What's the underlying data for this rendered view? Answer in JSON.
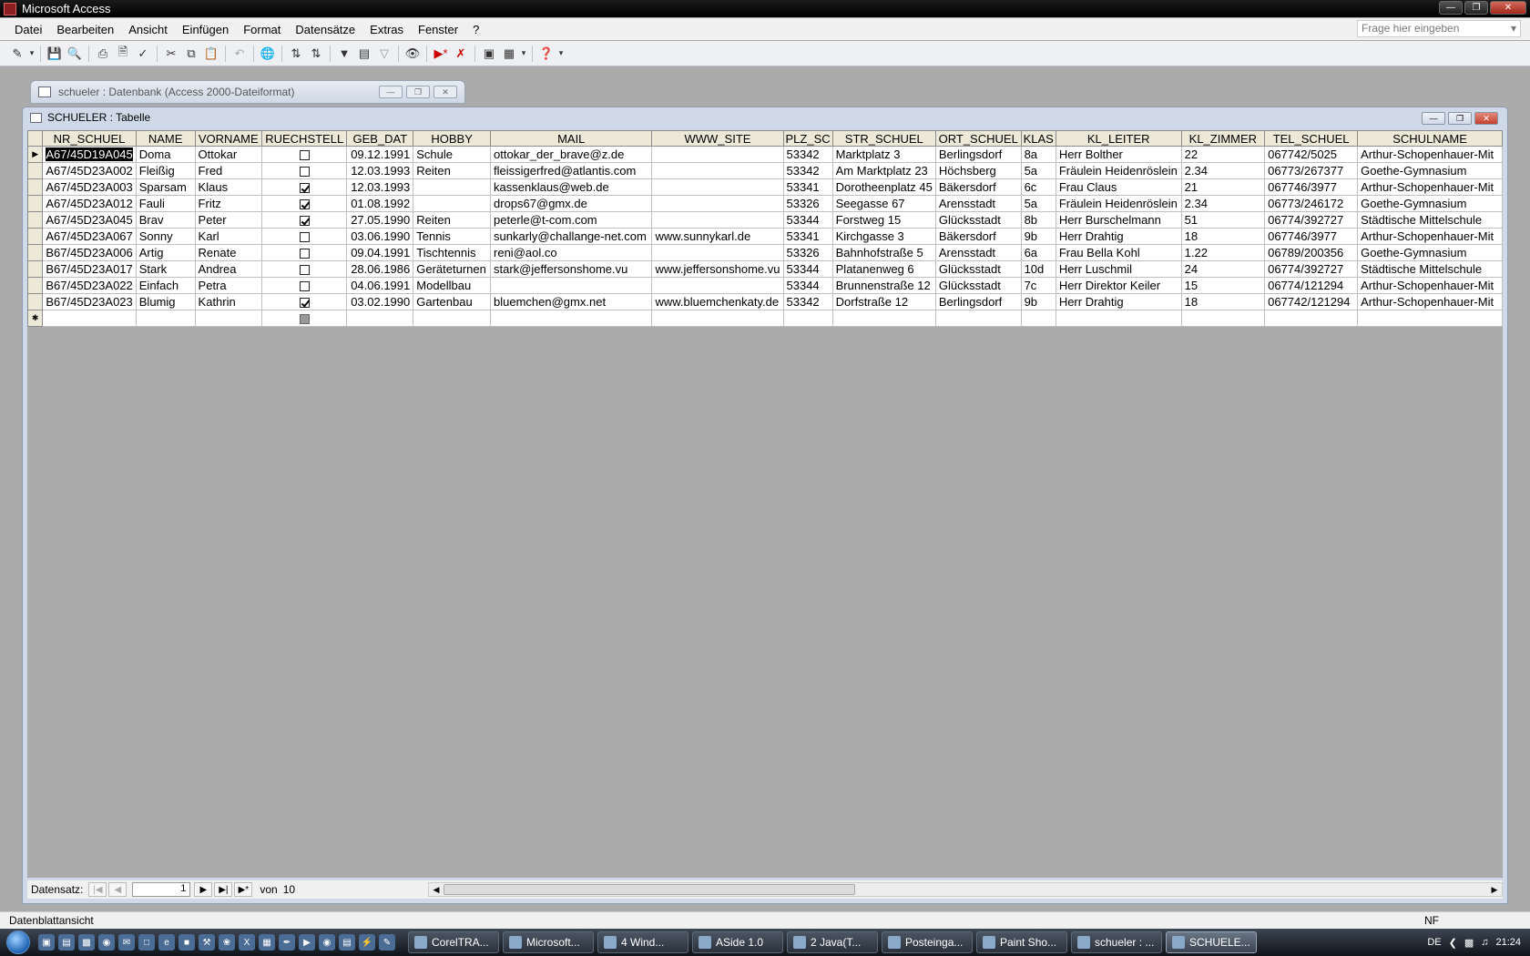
{
  "app": {
    "title": "Microsoft Access"
  },
  "menu": [
    "Datei",
    "Bearbeiten",
    "Ansicht",
    "Einfügen",
    "Format",
    "Datensätze",
    "Extras",
    "Fenster",
    "?"
  ],
  "help_search": {
    "placeholder": "Frage hier eingeben"
  },
  "db_window": {
    "title": "schueler : Datenbank (Access 2000-Dateiformat)"
  },
  "table_window": {
    "title": "SCHUELER : Tabelle"
  },
  "columns": [
    "NR_SCHUEL",
    "NAME",
    "VORNAME",
    "RUECHSTELL",
    "GEB_DAT",
    "HOBBY",
    "MAIL",
    "WWW_SITE",
    "PLZ_SC",
    "STR_SCHUEL",
    "ORT_SCHUEL",
    "KLAS",
    "KL_LEITER",
    "KL_ZIMMER",
    "TEL_SCHUEL",
    "SCHULNAME"
  ],
  "rows": [
    {
      "nr": "A67/45D19A045",
      "name": "Doma",
      "vorname": "Ottokar",
      "rueck": false,
      "geb": "09.12.1991",
      "hobby": "Schule",
      "mail": "ottokar_der_brave@z.de",
      "www": "",
      "plz": "53342",
      "str": "Marktplatz 3",
      "ort": "Berlingsdorf",
      "klasse": "8a",
      "leiter": "Herr Bolther",
      "zimmer": "22",
      "tel": "067742/5025",
      "schule": "Arthur-Schopenhauer-Mit"
    },
    {
      "nr": "A67/45D23A002",
      "name": "Fleißig",
      "vorname": "Fred",
      "rueck": false,
      "geb": "12.03.1993",
      "hobby": "Reiten",
      "mail": "fleissigerfred@atlantis.com",
      "www": "",
      "plz": "53342",
      "str": "Am Marktplatz 23",
      "ort": "Höchsberg",
      "klasse": "5a",
      "leiter": "Fräulein Heidenröslein",
      "zimmer": "2.34",
      "tel": "06773/267377",
      "schule": "Goethe-Gymnasium"
    },
    {
      "nr": "A67/45D23A003",
      "name": "Sparsam",
      "vorname": "Klaus",
      "rueck": true,
      "geb": "12.03.1993",
      "hobby": "",
      "mail": "kassenklaus@web.de",
      "www": "",
      "plz": "53341",
      "str": "Dorotheenplatz 45",
      "ort": "Bäkersdorf",
      "klasse": "6c",
      "leiter": "Frau Claus",
      "zimmer": "21",
      "tel": "067746/3977",
      "schule": "Arthur-Schopenhauer-Mit"
    },
    {
      "nr": "A67/45D23A012",
      "name": "Fauli",
      "vorname": "Fritz",
      "rueck": true,
      "geb": "01.08.1992",
      "hobby": "",
      "mail": "drops67@gmx.de",
      "www": "",
      "plz": "53326",
      "str": "Seegasse 67",
      "ort": "Arensstadt",
      "klasse": "5a",
      "leiter": "Fräulein Heidenröslein",
      "zimmer": "2.34",
      "tel": "06773/246172",
      "schule": "Goethe-Gymnasium"
    },
    {
      "nr": "A67/45D23A045",
      "name": "Brav",
      "vorname": "Peter",
      "rueck": true,
      "geb": "27.05.1990",
      "hobby": "Reiten",
      "mail": "peterle@t-com.com",
      "www": "",
      "plz": "53344",
      "str": "Forstweg 15",
      "ort": "Glücksstadt",
      "klasse": "8b",
      "leiter": "Herr Burschelmann",
      "zimmer": "51",
      "tel": "06774/392727",
      "schule": "Städtische Mittelschule"
    },
    {
      "nr": "A67/45D23A067",
      "name": "Sonny",
      "vorname": "Karl",
      "rueck": false,
      "geb": "03.06.1990",
      "hobby": "Tennis",
      "mail": "sunkarly@challange-net.com",
      "www": "www.sunnykarl.de",
      "plz": "53341",
      "str": "Kirchgasse 3",
      "ort": "Bäkersdorf",
      "klasse": "9b",
      "leiter": "Herr Drahtig",
      "zimmer": "18",
      "tel": "067746/3977",
      "schule": "Arthur-Schopenhauer-Mit"
    },
    {
      "nr": "B67/45D23A006",
      "name": "Artig",
      "vorname": "Renate",
      "rueck": false,
      "geb": "09.04.1991",
      "hobby": "Tischtennis",
      "mail": "reni@aol.co",
      "www": "",
      "plz": "53326",
      "str": "Bahnhofstraße 5",
      "ort": "Arensstadt",
      "klasse": "6a",
      "leiter": "Frau Bella Kohl",
      "zimmer": "1.22",
      "tel": "06789/200356",
      "schule": "Goethe-Gymnasium"
    },
    {
      "nr": "B67/45D23A017",
      "name": "Stark",
      "vorname": "Andrea",
      "rueck": false,
      "geb": "28.06.1986",
      "hobby": "Geräteturnen",
      "mail": "stark@jeffersonshome.vu",
      "www": "www.jeffersonshome.vu",
      "plz": "53344",
      "str": "Platanenweg 6",
      "ort": "Glücksstadt",
      "klasse": "10d",
      "leiter": "Herr Luschmil",
      "zimmer": "24",
      "tel": "06774/392727",
      "schule": "Städtische Mittelschule"
    },
    {
      "nr": "B67/45D23A022",
      "name": "Einfach",
      "vorname": "Petra",
      "rueck": false,
      "geb": "04.06.1991",
      "hobby": "Modellbau",
      "mail": "",
      "www": "",
      "plz": "53344",
      "str": "Brunnenstraße 12",
      "ort": "Glücksstadt",
      "klasse": "7c",
      "leiter": "Herr Direktor Keiler",
      "zimmer": "15",
      "tel": "06774/121294",
      "schule": "Arthur-Schopenhauer-Mit"
    },
    {
      "nr": "B67/45D23A023",
      "name": "Blumig",
      "vorname": "Kathrin",
      "rueck": true,
      "geb": "03.02.1990",
      "hobby": "Gartenbau",
      "mail": "bluemchen@gmx.net",
      "www": "www.bluemchenkaty.de",
      "plz": "53342",
      "str": "Dorfstraße 12",
      "ort": "Berlingsdorf",
      "klasse": "9b",
      "leiter": "Herr Drahtig",
      "zimmer": "18",
      "tel": "067742/121294",
      "schule": "Arthur-Schopenhauer-Mit"
    }
  ],
  "record_nav": {
    "label": "Datensatz:",
    "current": "1",
    "of_label": "von",
    "total": "10"
  },
  "status": {
    "left": "Datenblattansicht",
    "right": "NF"
  },
  "taskbar": {
    "tasks": [
      "CorelTRA...",
      "Microsoft...",
      "4 Wind...",
      "ASide 1.0",
      "2 Java(T...",
      "Posteinga...",
      "Paint Sho...",
      "schueler : ...",
      "SCHUELE..."
    ],
    "lang": "DE",
    "clock": "21:24"
  }
}
